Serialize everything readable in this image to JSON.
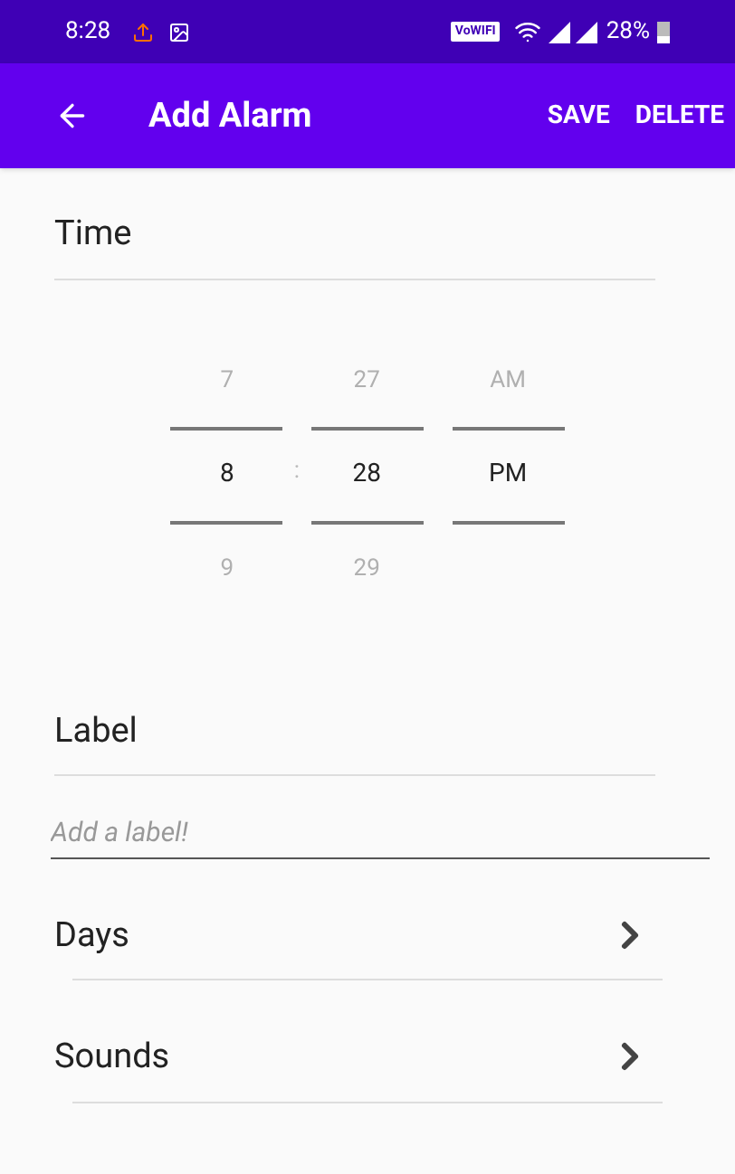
{
  "status_bar": {
    "time": "8:28",
    "wifi_badge": "VoWIFI",
    "battery": "28%"
  },
  "app_bar": {
    "title": "Add Alarm",
    "actions": [
      "SAVE",
      "DELETE"
    ]
  },
  "time_section": {
    "heading": "Time",
    "separator": ":",
    "columns": [
      {
        "items": [
          {
            "text": "7",
            "selected": false
          },
          {
            "text": "8",
            "selected": true
          },
          {
            "text": "9",
            "selected": false
          }
        ]
      },
      {
        "items": [
          {
            "text": "27",
            "selected": false
          },
          {
            "text": "28",
            "selected": true
          },
          {
            "text": "29",
            "selected": false
          }
        ]
      },
      {
        "items": [
          {
            "text": "AM",
            "selected": false
          },
          {
            "text": "PM",
            "selected": true
          }
        ]
      }
    ]
  },
  "label_section": {
    "heading": "Label",
    "placeholder": "Add a label!"
  },
  "rows": [
    {
      "label": "Days"
    },
    {
      "label": "Sounds"
    }
  ]
}
